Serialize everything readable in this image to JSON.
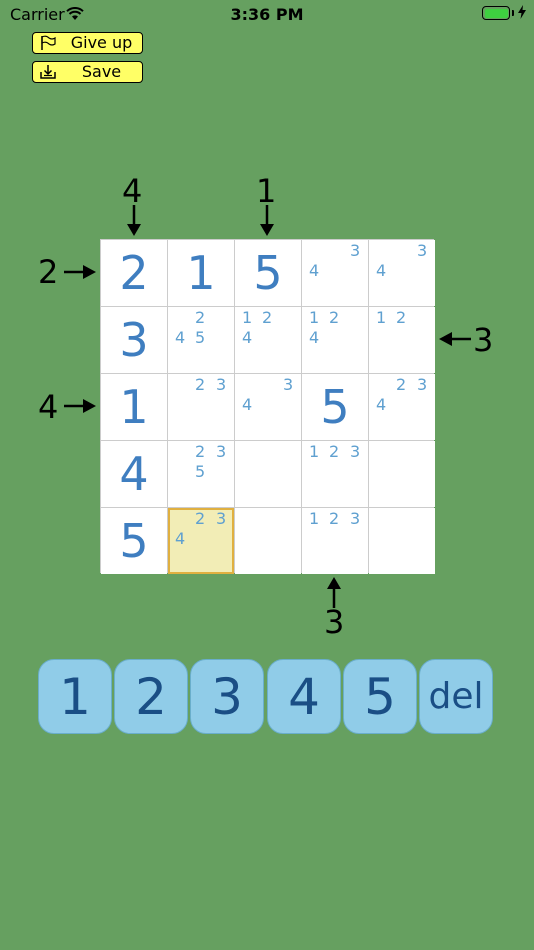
{
  "status": {
    "carrier": "Carrier",
    "time": "3:36 PM",
    "battery_level": 1.0
  },
  "buttons": {
    "give_up": "Give up",
    "save": "Save",
    "give_up_icon": "flag-icon",
    "save_icon": "save-tray-icon"
  },
  "clues": {
    "top_col1": "4",
    "top_col3": "1",
    "left_row1": "2",
    "left_row3": "4",
    "right_row2": "3",
    "bottom_col4": "3"
  },
  "grid": {
    "size": 5,
    "selected_cell": [
      4,
      1
    ],
    "cells": [
      [
        {
          "value": "2"
        },
        {
          "value": "1"
        },
        {
          "value": "5"
        },
        {
          "candidates": [
            "3",
            "4"
          ]
        },
        {
          "candidates": [
            "3",
            "4"
          ]
        }
      ],
      [
        {
          "value": "3"
        },
        {
          "candidates": [
            "2",
            "4",
            "5"
          ]
        },
        {
          "candidates": [
            "1",
            "2",
            "4"
          ]
        },
        {
          "candidates": [
            "1",
            "2",
            "4"
          ]
        },
        {
          "candidates": [
            "1",
            "2"
          ]
        }
      ],
      [
        {
          "value": "1"
        },
        {
          "candidates": [
            "2",
            "3"
          ]
        },
        {
          "candidates": [
            "3",
            "4"
          ]
        },
        {
          "value": "5"
        },
        {
          "candidates": [
            "2",
            "3",
            "4"
          ]
        }
      ],
      [
        {
          "value": "4"
        },
        {
          "candidates": [
            "2",
            "3",
            "5"
          ]
        },
        {},
        {
          "candidates": [
            "1",
            "2",
            "3"
          ]
        },
        {}
      ],
      [
        {
          "value": "5"
        },
        {
          "candidates": [
            "2",
            "3",
            "4"
          ]
        },
        {},
        {
          "candidates": [
            "1",
            "2",
            "3"
          ]
        },
        {}
      ]
    ]
  },
  "keypad": [
    "1",
    "2",
    "3",
    "4",
    "5",
    "del"
  ]
}
